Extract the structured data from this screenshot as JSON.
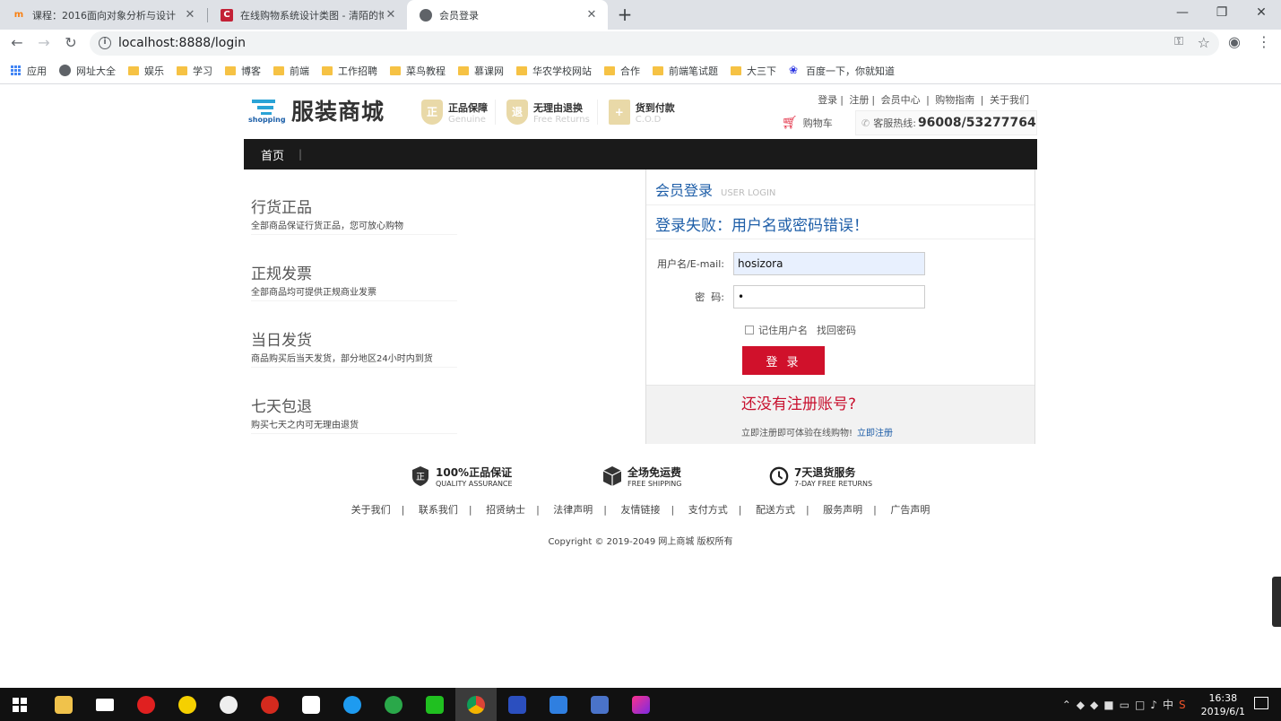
{
  "browser": {
    "tabs": [
      {
        "title": "课程：2016面向对象分析与设计"
      },
      {
        "title": "在线购物系统设计类图 - 清陌的博"
      },
      {
        "title": "会员登录"
      }
    ],
    "new_tab": "+",
    "url": "localhost:8888/login",
    "bookmarks": [
      "应用",
      "网址大全",
      "娱乐",
      "学习",
      "博客",
      "前端",
      "工作招聘",
      "菜鸟教程",
      "慕课网",
      "华农学校网站",
      "合作",
      "前端笔试题",
      "大三下",
      "百度一下，你就知道"
    ]
  },
  "header": {
    "brand": "服装商城",
    "logo_text": "shopping",
    "badges": [
      {
        "cn": "正品保障",
        "en": "Genuine",
        "glyph": "正"
      },
      {
        "cn": "无理由退换",
        "en": "Free Returns",
        "glyph": "退"
      },
      {
        "cn": "货到付款",
        "en": "C.O.D",
        "glyph": "+"
      }
    ],
    "links": [
      "登录",
      "注册",
      "会员中心",
      "购物指南",
      "关于我们"
    ],
    "cart": "购物车",
    "hotline_label": "客服热线:",
    "hotline_number": "96008/53277764"
  },
  "nav": {
    "home": "首页",
    "sep": "|"
  },
  "promises": [
    {
      "title": "行货正品",
      "sub": "全部商品保证行货正品，您可放心购物"
    },
    {
      "title": "正规发票",
      "sub": "全部商品均可提供正规商业发票"
    },
    {
      "title": "当日发货",
      "sub": "商品购买后当天发货，部分地区24小时内到货"
    },
    {
      "title": "七天包退",
      "sub": "购买七天之内可无理由退货"
    }
  ],
  "login": {
    "title": "会员登录",
    "title_en": "USER LOGIN",
    "error": "登录失败：用户名或密码错误！",
    "username_label": "用户名/E-mail:",
    "username_value": "hosizora",
    "password_label": "密  码:",
    "password_value": "•",
    "remember": "记住用户名",
    "forgot": "找回密码",
    "submit": "登 录",
    "no_account": "还没有注册账号?",
    "register_hint": "立即注册即可体验在线购物!",
    "register_link": "立即注册"
  },
  "services": [
    {
      "cn": "100%正品保证",
      "en": "QUALITY ASSURANCE",
      "icon": "shield-icon"
    },
    {
      "cn": "全场免运费",
      "en": "FREE SHIPPING",
      "icon": "box-icon"
    },
    {
      "cn": "7天退货服务",
      "en": "7-DAY FREE RETURNS",
      "icon": "clock-icon"
    }
  ],
  "footer_links": [
    "关于我们",
    "联系我们",
    "招贤纳士",
    "法律声明",
    "友情链接",
    "支付方式",
    "配送方式",
    "服务声明",
    "广告声明"
  ],
  "copyright": "Copyright © 2019-2049 网上商城 版权所有",
  "taskbar": {
    "time": "16:38",
    "date": "2019/6/1",
    "ime": "中"
  },
  "colors": {
    "brand_blue": "#1e5ea8",
    "accent_red": "#d0112b",
    "nav_black": "#1a1a1a"
  }
}
